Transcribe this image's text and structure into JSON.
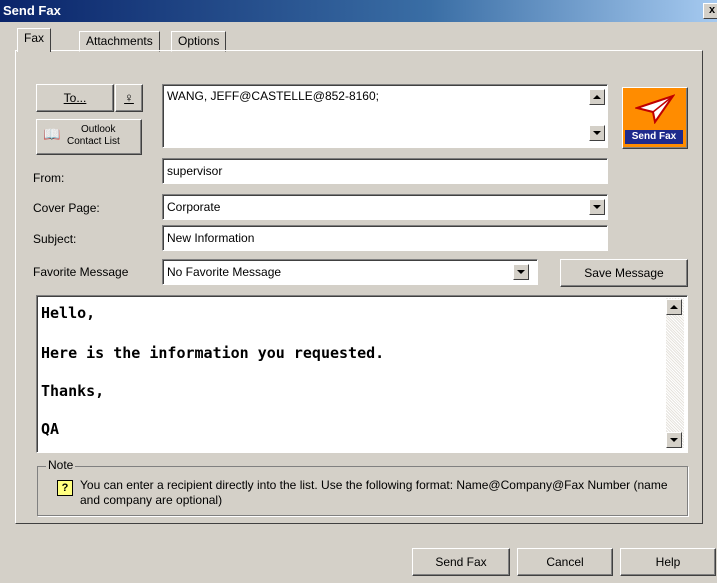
{
  "window": {
    "title": "Send Fax",
    "close": "x"
  },
  "tabs": [
    {
      "label": "Fax",
      "active": true
    },
    {
      "label": "Attachments",
      "active": false
    },
    {
      "label": "Options",
      "active": false
    }
  ],
  "recipients": {
    "to_label": "To...",
    "outlook_label_line1": "Outlook",
    "outlook_label_line2": "Contact List",
    "list_value": "WANG, JEFF@CASTELLE@852-8160;"
  },
  "send_fax_icon": {
    "label": "Send Fax"
  },
  "form": {
    "from_label": "From:",
    "from_value": "supervisor",
    "cover_label": "Cover Page:",
    "cover_value": "Corporate",
    "subject_label": "Subject:",
    "subject_value": "New Information",
    "favorite_label": "Favorite Message",
    "favorite_value": "No Favorite Message",
    "save_message_label": "Save Message"
  },
  "message": {
    "lines": [
      "Hello,",
      "Here is the information you requested.",
      "Thanks,",
      "QA"
    ]
  },
  "note": {
    "label": "Note",
    "text": "You can enter a recipient directly into the list. Use the following format: Name@Company@Fax Number  (name and company are optional)"
  },
  "footer": {
    "send_fax": "Send Fax",
    "cancel": "Cancel",
    "help": "Help"
  }
}
